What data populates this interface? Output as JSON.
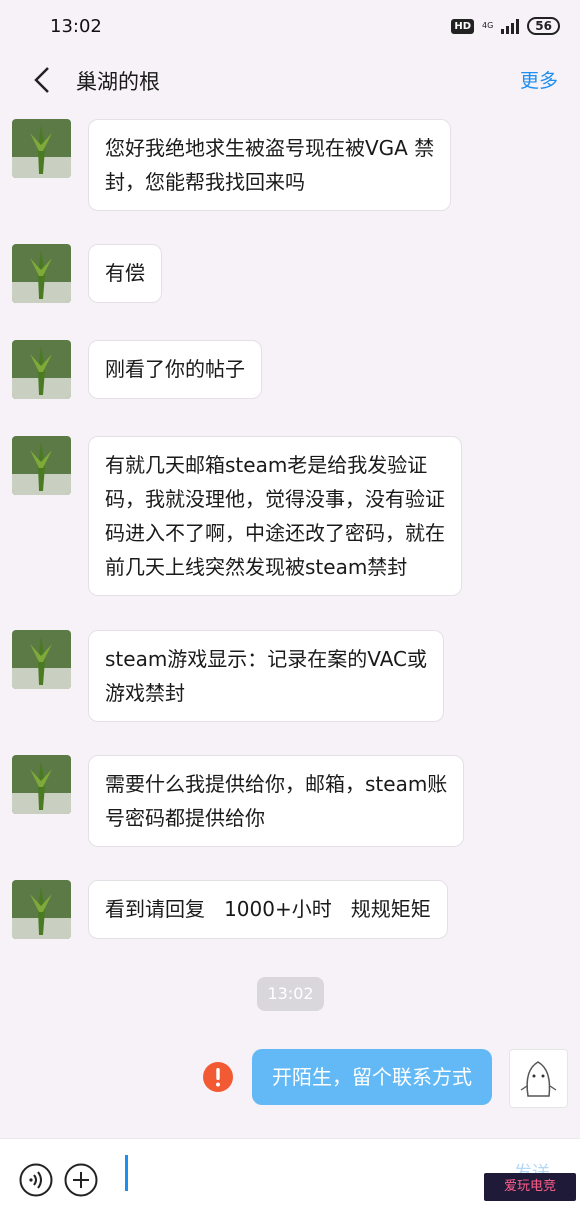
{
  "status_bar": {
    "time": "13:02",
    "hd": "HD",
    "network": "4G",
    "battery": "56"
  },
  "header": {
    "title": "巢湖的根",
    "more": "更多"
  },
  "messages": [
    "您好我绝地求生被盗号现在被VGA 禁\n封，您能帮我找回来吗",
    "有偿",
    "刚看了你的帖子",
    "有就几天邮箱steam老是给我发验证\n码，我就没理他，觉得没事，没有验证\n码进入不了啊，中途还改了密码，就在\n前几天上线突然发现被steam禁封",
    "steam游戏显示：记录在案的VAC或\n游戏禁封",
    "需要什么我提供给你，邮箱，steam账\n号密码都提供给你",
    "看到请回复   1000+小时   规规矩矩"
  ],
  "timestamp": "13:02",
  "outgoing": "开陌生，留个联系方式",
  "input": {
    "send_label": "发送"
  },
  "watermark": "爱玩电竞",
  "colors": {
    "accent": "#1c8ff0",
    "outgoing_bubble": "#62b9f5",
    "error": "#f25a33"
  }
}
